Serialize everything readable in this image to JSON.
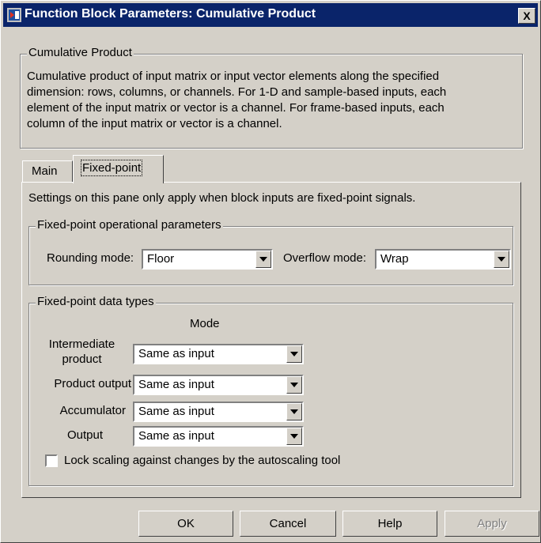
{
  "window": {
    "title": "Function Block Parameters: Cumulative Product",
    "close_glyph": "X"
  },
  "description_group": {
    "legend": "Cumulative Product",
    "lines": [
      "Cumulative product of input matrix or input vector elements along the specified",
      "dimension: rows, columns, or channels.  For 1-D and sample-based inputs, each",
      "element of the input matrix or vector is a channel.  For frame-based inputs, each",
      "column of the input matrix or vector is a channel."
    ]
  },
  "tabs": [
    {
      "label": "Main"
    },
    {
      "label": "Fixed-point"
    }
  ],
  "panel": {
    "note": "Settings on this pane only apply when block inputs are fixed-point signals.",
    "operational": {
      "legend": "Fixed-point operational parameters",
      "rounding_label": "Rounding mode:",
      "rounding_value": "Floor",
      "overflow_label": "Overflow mode:",
      "overflow_value": "Wrap"
    },
    "data_types": {
      "legend": "Fixed-point data types",
      "mode_header": "Mode",
      "rows": [
        {
          "label_line1": "Intermediate",
          "label_line2": "product",
          "value": "Same as input"
        },
        {
          "label": "Product output",
          "value": "Same as input"
        },
        {
          "label": "Accumulator",
          "value": "Same as input"
        },
        {
          "label": "Output",
          "value": "Same as input"
        }
      ],
      "lock_scaling_label": "Lock scaling against changes by the autoscaling tool",
      "lock_scaling_checked": false
    }
  },
  "buttons": {
    "ok": "OK",
    "cancel": "Cancel",
    "help": "Help",
    "apply": "Apply"
  }
}
